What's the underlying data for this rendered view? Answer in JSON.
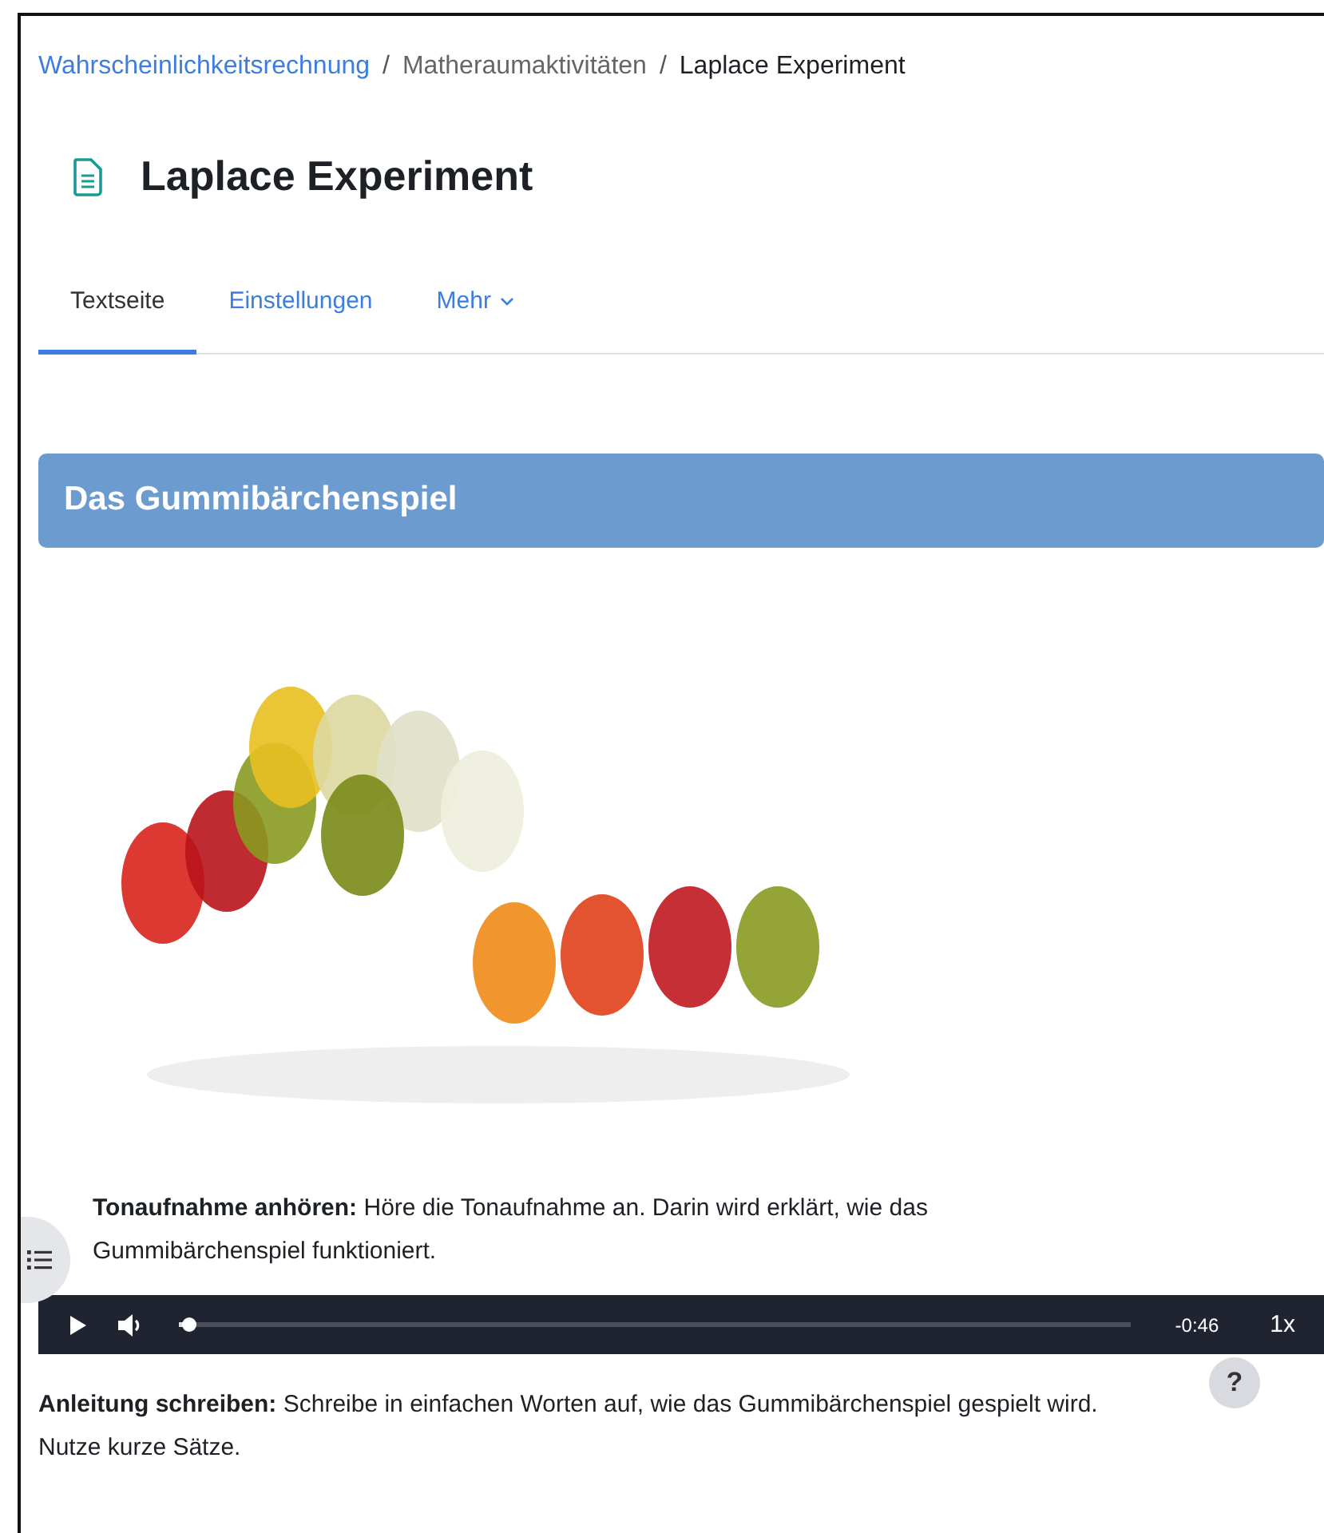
{
  "breadcrumb": [
    {
      "label": "Wahrscheinlichkeitsrechnung",
      "kind": "link"
    },
    {
      "label": "Matheraumaktivitäten",
      "kind": "muted"
    },
    {
      "label": "Laplace Experiment",
      "kind": "current"
    }
  ],
  "breadcrumb_separators": [
    "/",
    "/"
  ],
  "page": {
    "title": "Laplace Experiment"
  },
  "tabs": [
    {
      "label": "Textseite",
      "selected": true,
      "dropdown": false
    },
    {
      "label": "Einstellungen",
      "selected": false,
      "dropdown": false
    },
    {
      "label": "Mehr",
      "selected": false,
      "dropdown": true
    }
  ],
  "section": {
    "heading": "Das Gummibärchenspiel"
  },
  "image": {
    "kind": "picture"
  },
  "paragraphs": [
    {
      "text": "**Tonaufnahme anhören:** Höre die Tonaufnahme an. Darin wird erklärt, wie das Gummibärchenspiel funktioniert."
    }
  ],
  "audio_player": {
    "level": 0.01,
    "time": "-0:46",
    "speed": "1x"
  },
  "paragraphs_after": [
    {
      "text": "**Anleitung schreiben:** Schreibe in einfachen Worten auf, wie das Gummibärchenspiel gespielt wird. Nutze kurze Sätze."
    }
  ],
  "floating": {
    "help": "?"
  }
}
